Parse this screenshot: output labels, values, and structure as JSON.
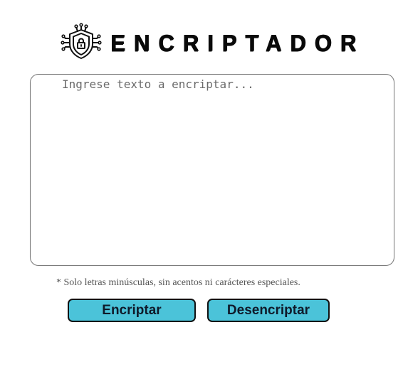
{
  "header": {
    "title": "ENCRIPTADOR",
    "logo_icon": "shield-lock-circuit-icon"
  },
  "input": {
    "value": "",
    "placeholder": "Ingrese texto a encriptar..."
  },
  "hint": "* Solo letras minúsculas, sin acentos ni carácteres especiales.",
  "buttons": {
    "encrypt_label": "Encriptar",
    "decrypt_label": "Desencriptar"
  },
  "colors": {
    "button_bg": "#4bc3d9",
    "button_border": "#111111",
    "title": "#0a0a0a"
  }
}
